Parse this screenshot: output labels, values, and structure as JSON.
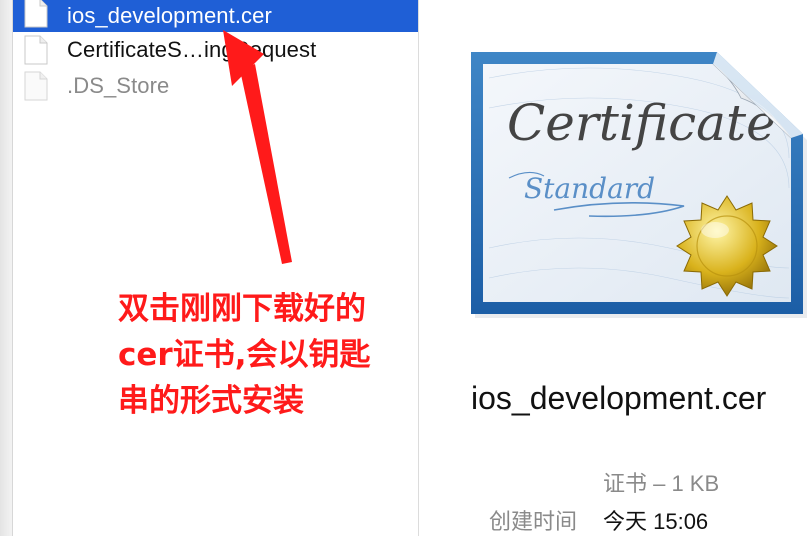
{
  "files": [
    {
      "name": "ios_development.cer",
      "selected": true
    },
    {
      "name": "CertificateS…ingRequest",
      "selected": false
    },
    {
      "name": ".DS_Store",
      "selected": false,
      "dim": true
    }
  ],
  "preview": {
    "title": "ios_development.cer",
    "kind_size": "证书 – 1 KB",
    "created_label": "创建时间",
    "created_value": "今天 15:06",
    "icon": "certificate-icon"
  },
  "annotation": {
    "lines": [
      "双击刚刚下载好的",
      "cer证书,会以钥匙",
      "串的形式安装"
    ],
    "color": "#ff1a1a"
  },
  "colors": {
    "selection": "#1f5fd6",
    "secondary_text": "#8a8a8a"
  }
}
